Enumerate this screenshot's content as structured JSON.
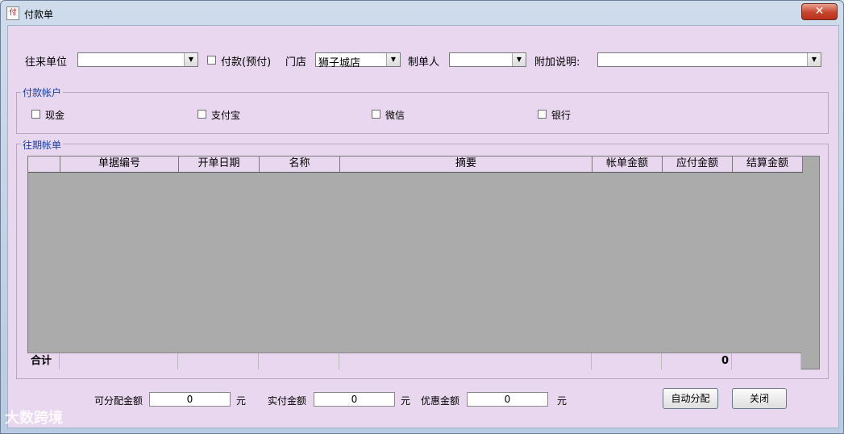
{
  "window": {
    "title": "付款单",
    "close_symbol": "✕"
  },
  "header": {
    "partner_label": "往来单位",
    "partner_value": "",
    "prepay_label": "付款(预付)",
    "prepay_checked": false,
    "store_label": "门店",
    "store_value": "狮子城店",
    "maker_label": "制单人",
    "maker_value": "",
    "note_label": "附加说明:",
    "note_value": ""
  },
  "accounts": {
    "title": "付款帐户",
    "items": [
      {
        "label": "现金",
        "checked": false
      },
      {
        "label": "支付宝",
        "checked": false
      },
      {
        "label": "微信",
        "checked": false
      },
      {
        "label": "银行",
        "checked": false
      }
    ]
  },
  "bills": {
    "title": "往期帐单",
    "columns": [
      "",
      "单据编号",
      "开单日期",
      "名称",
      "摘要",
      "帐单金额",
      "应付金额",
      "结算金额"
    ],
    "rows": [],
    "footer": {
      "label": "合计",
      "payable_total": "0"
    }
  },
  "bottom": {
    "allocatable_label": "可分配金额",
    "allocatable_value": "0",
    "allocatable_unit": "元",
    "paid_label": "实付金额",
    "paid_value": "0",
    "paid_unit": "元",
    "discount_label": "优惠金额",
    "discount_value": "0",
    "discount_unit": "元",
    "auto_button": "自动分配",
    "close_button": "关闭"
  },
  "watermark": "大数跨境"
}
